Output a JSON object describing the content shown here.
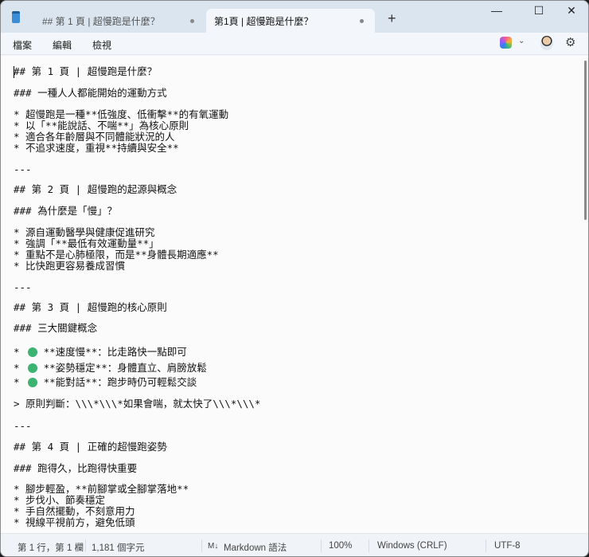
{
  "tabs": [
    {
      "label": "## 第 1 頁 | 超慢跑是什麼？"
    },
    {
      "label": "第1頁 | 超慢跑是什麼？"
    }
  ],
  "menu": [
    "檔案",
    "編輯",
    "檢視"
  ],
  "window_controls": {
    "minimize": "—",
    "maximize": "☐",
    "close": "✕",
    "new_tab": "+"
  },
  "editor_lines": [
    "## 第 1 頁 | 超慢跑是什麼？",
    "### 一種人人都能開始的運動方式",
    "* 超慢跑是一種**低強度、低衝擊**的有氧運動",
    "* 以「**能說話、不喘**」為核心原則",
    "* 適合各年齡層與不同體能狀況的人",
    "* 不追求速度，重視**持續與安全**",
    "---",
    "## 第 2 頁 | 超慢跑的起源與概念",
    "### 為什麼是「慢」？",
    "* 源自運動醫學與健康促進研究",
    "* 強調「**最低有效運動量**」",
    "* 重點不是心肺極限，而是**身體長期適應**",
    "* 比快跑更容易養成習慣",
    "---",
    "## 第 3 頁 | 超慢跑的核心原則",
    "### 三大關鍵概念",
    "*    **速度慢**：比走路快一點即可",
    "*    **姿勢穩定**：身體直立、肩膀放鬆",
    "*    **能對話**：跑步時仍可輕鬆交談",
    "> 原則判斷：\\\\\\*\\\\\\*如果會喘，就太快了\\\\\\*\\\\\\*",
    "---",
    "## 第 4 頁 | 正確的超慢跑姿勢",
    "### 跑得久，比跑得快重要",
    "* 腳步輕盈，**前腳掌或全腳掌落地**",
    "* 步伐小、節奏穩定",
    "* 手自然擺動，不刻意用力",
    "* 視線平視前方，避免低頭"
  ],
  "status": {
    "position": "第 1 行，第 1 欄",
    "chars": "1,181 個字元",
    "format": "Markdown 語法",
    "format_icon": "M↓",
    "zoom": "100%",
    "line_ending": "Windows (CRLF)",
    "encoding": "UTF-8"
  },
  "colors": {
    "green_dot": "#3cb371",
    "titlebar": "#dbe5f0"
  }
}
